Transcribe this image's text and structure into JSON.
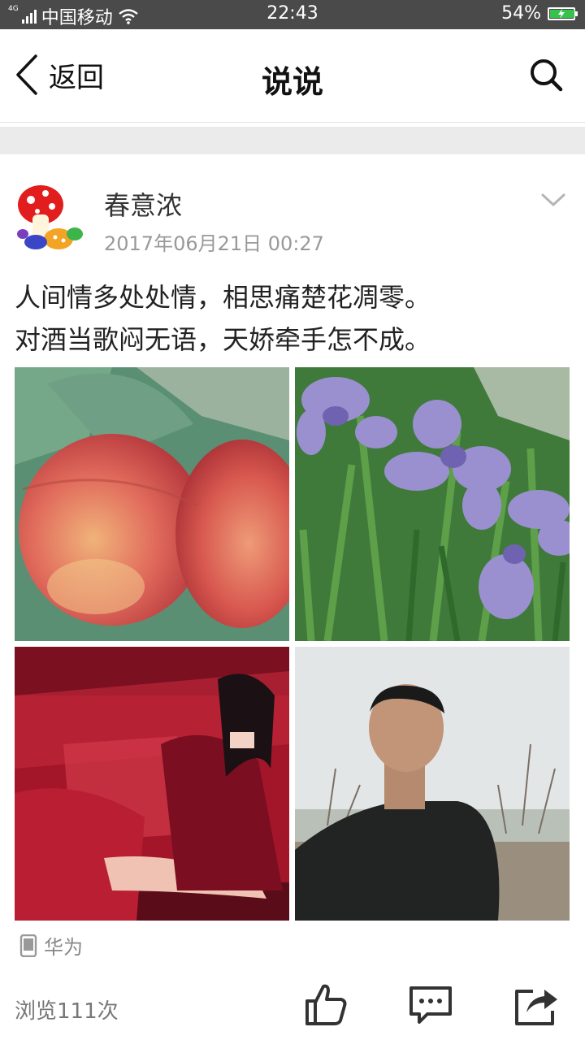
{
  "status_bar": {
    "network": "4G",
    "carrier": "中国移动",
    "time": "22:43",
    "battery": "54%",
    "battery_color": "#36c24b"
  },
  "header": {
    "back_label": "返回",
    "title": "说说",
    "search_icon": "search-icon"
  },
  "post": {
    "username": "春意浓",
    "timestamp": "2017年06月21日 00:27",
    "lines": [
      "人间情多处处情，相思痛楚花凋零。",
      "对酒当歌闷无语，天娇牵手怎不成。"
    ],
    "photos": [
      "peach-photo",
      "iris-flowers-photo",
      "woman-in-red-photo",
      "man-portrait-photo"
    ],
    "device": "华为",
    "views": "浏览111次"
  },
  "actions": [
    "thumbs-up-icon",
    "comment-icon",
    "share-icon"
  ]
}
